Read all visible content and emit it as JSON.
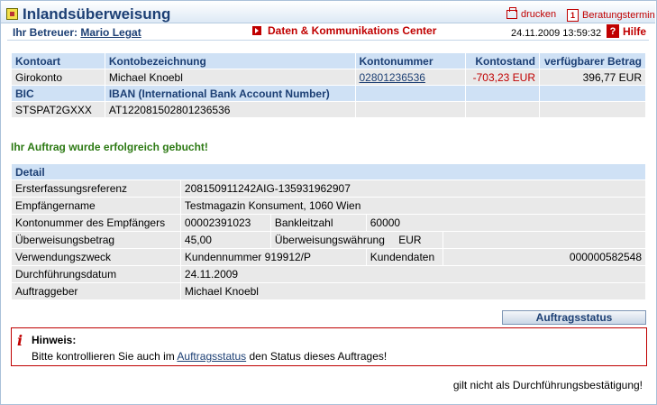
{
  "header": {
    "title": "Inlandsüberweisung",
    "print_label": "drucken",
    "consult_label": "Beratungstermin"
  },
  "subheader": {
    "betreuer_label": "Ihr Betreuer:",
    "betreuer_name": "Mario Legat",
    "dkc_label": "Daten & Kommunikations Center",
    "datetime": "24.11.2009 13:59:32",
    "help_label": "Hilfe"
  },
  "account": {
    "headers": [
      "Kontoart",
      "Kontobezeichnung",
      "Kontonummer",
      "Kontostand",
      "verfügbarer Betrag"
    ],
    "row": {
      "kontoart": "Girokonto",
      "bezeichnung": "Michael Knoebl",
      "nummer": "02801236536",
      "stand": "-703,23 EUR",
      "verfuegbar": "396,77 EUR"
    },
    "iban_headers": [
      "BIC",
      "IBAN (International Bank Account Number)"
    ],
    "iban_row": {
      "bic": "STSPAT2GXXX",
      "iban": "AT122081502801236536"
    }
  },
  "status_message": "Ihr Auftrag wurde erfolgreich gebucht!",
  "detail": {
    "header": "Detail",
    "erstref_label": "Ersterfassungsreferenz",
    "erstref_value": "208150911242AIG-135931962907",
    "empf_label": "Empfängername",
    "empf_value": "Testmagazin Konsument, 1060 Wien",
    "ktonr_label": "Kontonummer des Empfängers",
    "ktonr_value": "00002391023",
    "blz_label": "Bankleitzahl",
    "blz_value": "60000",
    "betrag_label": "Überweisungsbetrag",
    "betrag_value": "45,00",
    "waehrung_label": "Überweisungswährung",
    "waehrung_value": "EUR",
    "zweck_label": "Verwendungszweck",
    "zweck_value": "Kundennummer 919912/P",
    "kundendaten_label": "Kundendaten",
    "kundendaten_value": "000000582548",
    "datum_label": "Durchführungsdatum",
    "datum_value": "24.11.2009",
    "auftraggeber_label": "Auftraggeber",
    "auftraggeber_value": "Michael Knoebl"
  },
  "button_auftragsstatus": "Auftragsstatus",
  "hinweis": {
    "title": "Hinweis:",
    "text_before": "Bitte kontrollieren Sie auch im ",
    "link": "Auftragsstatus",
    "text_after": " den Status dieses Auftrages!"
  },
  "footer": "gilt nicht als Durchführungsbestätigung!",
  "colors": {
    "accent_blue": "#1c3f74",
    "accent_red": "#c00000",
    "success_green": "#2d7a14"
  }
}
